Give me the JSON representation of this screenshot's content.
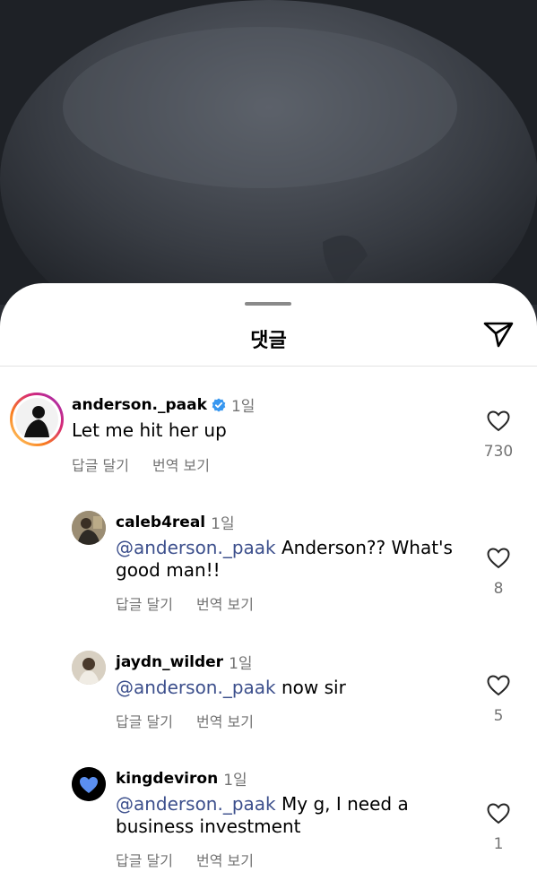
{
  "sheet": {
    "title": "댓글"
  },
  "icons": {
    "send": "send-icon",
    "like": "heart-outline-icon",
    "verified": "verified-badge-icon"
  },
  "colors": {
    "mention": "#3c4f8c",
    "verified": "#3797f0",
    "muted": "#737373"
  },
  "comments": [
    {
      "username": "anderson._paak",
      "verified": true,
      "time": "1일",
      "mention": "",
      "text": "Let me hit her up",
      "reply_label": "답글 달기",
      "translate_label": "번역 보기",
      "likes": "730"
    },
    {
      "username": "caleb4real",
      "time": "1일",
      "mention": "@anderson._paak",
      "text": " Anderson?? What's good man!!",
      "reply_label": "답글 달기",
      "translate_label": "번역 보기",
      "likes": "8"
    },
    {
      "username": "jaydn_wilder",
      "time": "1일",
      "mention": "@anderson._paak",
      "text": " now sir",
      "reply_label": "답글 달기",
      "translate_label": "번역 보기",
      "likes": "5"
    },
    {
      "username": "kingdeviron",
      "time": "1일",
      "mention": "@anderson._paak",
      "text": " My g, I need a business investment",
      "reply_label": "답글 달기",
      "translate_label": "번역 보기",
      "likes": "1"
    }
  ]
}
